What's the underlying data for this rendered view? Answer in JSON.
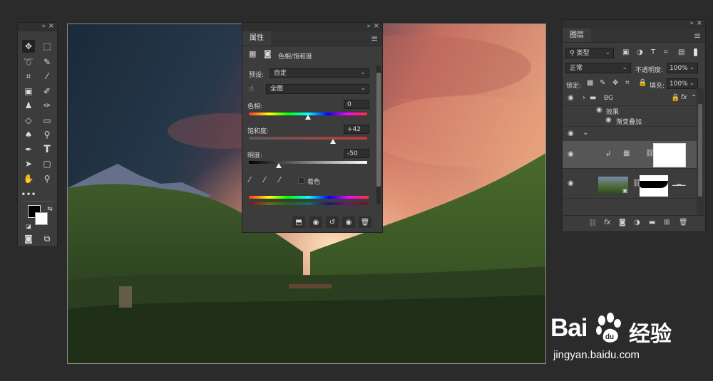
{
  "colors": {
    "background": "#2b2b2b",
    "panel": "#3c3c3c",
    "hue_gradient": "rainbow",
    "saturation_track": "#c33a3a"
  },
  "toolbar": {
    "collapse_label": "»",
    "close_label": "×",
    "tools": [
      "move-tool-icon",
      "marquee-tool-icon",
      "lasso-tool-icon",
      "quick-select-tool-icon",
      "crop-tool-icon",
      "eyedropper-tool-icon",
      "frame-tool-icon",
      "brush-tool-icon",
      "stamp-tool-icon",
      "history-brush-tool-icon",
      "eraser-tool-icon",
      "gradient-tool-icon",
      "blur-tool-icon",
      "dodge-tool-icon",
      "pen-tool-icon",
      "type-tool-icon",
      "path-select-tool-icon",
      "rectangle-tool-icon",
      "hand-tool-icon",
      "zoom-tool-icon",
      "more-tools-icon"
    ],
    "type_label": "T",
    "more_label": "•••"
  },
  "properties": {
    "tab_label": "属性",
    "adjustment_name": "色相/饱和度",
    "preset_label": "预设:",
    "preset_value": "自定",
    "channel_value": "全图",
    "hue": {
      "label": "色相:",
      "value": "0",
      "level": 0.5
    },
    "saturation": {
      "label": "饱和度:",
      "value": "+42",
      "level": 0.71
    },
    "lightness": {
      "label": "明度:",
      "value": "-50",
      "level": 0.25
    },
    "colorize_label": "着色",
    "collapse_label": "»",
    "close_label": "×"
  },
  "layers": {
    "tab_label": "图层",
    "filter_kind": "类型",
    "blend_mode": "正常",
    "opacity_label": "不透明度:",
    "opacity_value": "100%",
    "lock_label": "锁定:",
    "fill_label": "填充:",
    "fill_value": "100%",
    "group_name": "BG",
    "fx_label": "fx",
    "effects_label": "效果",
    "effect_item": "渐变叠加",
    "collapse_label": "»",
    "close_label": "×"
  },
  "watermark": {
    "brand": "Bai",
    "brand_cn": "经验",
    "url": "jingyan.baidu.com"
  }
}
